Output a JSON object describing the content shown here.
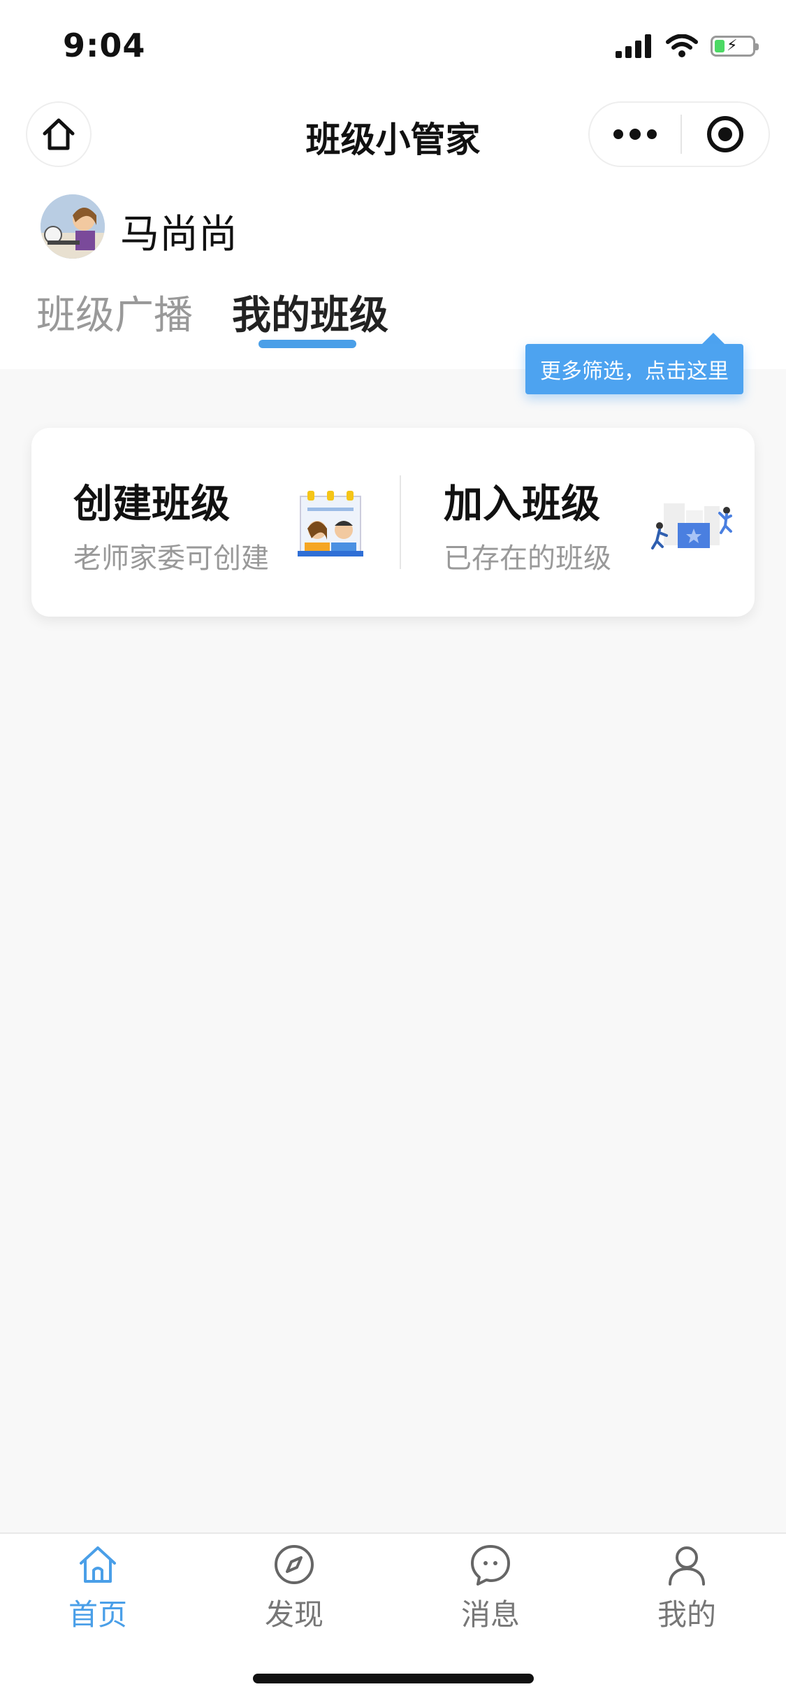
{
  "status_bar": {
    "time": "9:04"
  },
  "header": {
    "title": "班级小管家"
  },
  "user": {
    "name": "马尚尚"
  },
  "tabs": [
    {
      "label": "班级广播",
      "active": false
    },
    {
      "label": "我的班级",
      "active": true
    }
  ],
  "tooltip": {
    "text": "更多筛选，点击这里"
  },
  "actions": {
    "create": {
      "title": "创建班级",
      "subtitle": "老师家委可创建"
    },
    "join": {
      "title": "加入班级",
      "subtitle": "已存在的班级"
    }
  },
  "tabbar": [
    {
      "label": "首页",
      "icon": "home-icon",
      "active": true
    },
    {
      "label": "发现",
      "icon": "compass-icon",
      "active": false
    },
    {
      "label": "消息",
      "icon": "message-icon",
      "active": false
    },
    {
      "label": "我的",
      "icon": "user-icon",
      "active": false
    }
  ],
  "colors": {
    "accent": "#4a9fe8",
    "tooltip": "#4da3f0",
    "inactive": "#999999",
    "background": "#f8f8f8"
  }
}
